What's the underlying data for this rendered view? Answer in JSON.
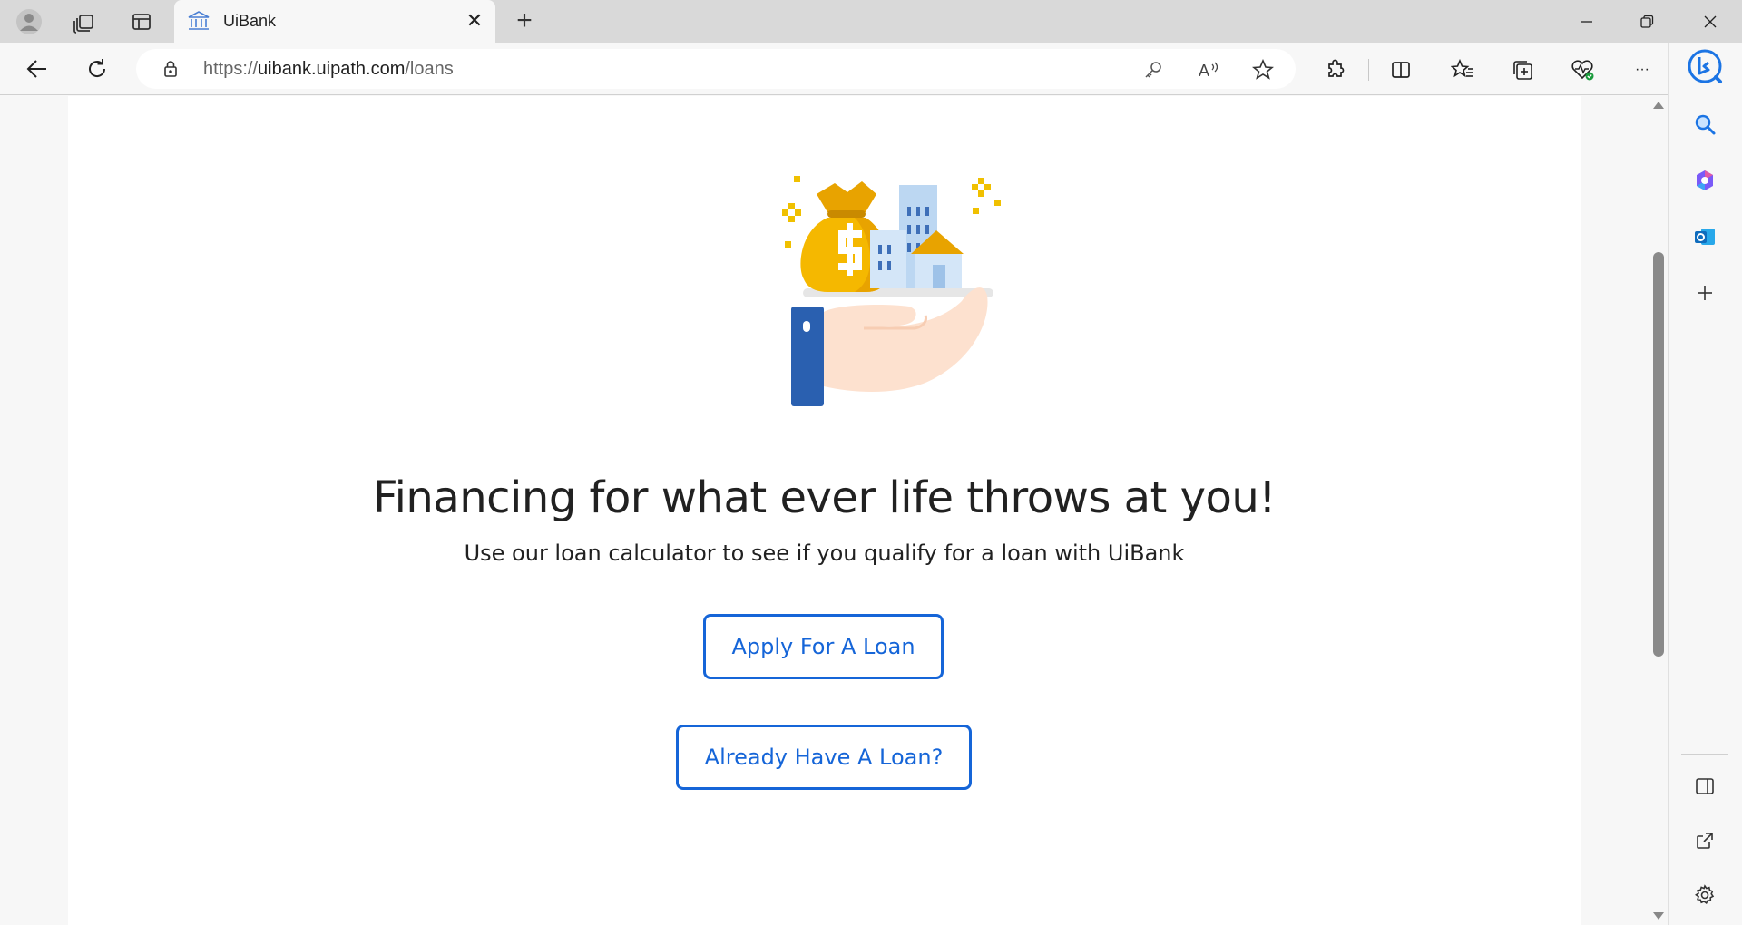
{
  "browser": {
    "tab": {
      "title": "UiBank",
      "close": "✕"
    },
    "new_tab": "+",
    "address": {
      "scheme": "https://",
      "host": "uibank.uipath.com",
      "path": "/loans"
    },
    "more": "···"
  },
  "page": {
    "headline": "Financing for what ever life throws at you!",
    "subline": "Use our loan calculator to see if you qualify for a loan with UiBank",
    "apply_button": "Apply For A Loan",
    "have_loan_button": "Already Have A Loan?"
  },
  "colors": {
    "accent": "#1565d8",
    "tab_bar": "#d9d9d9",
    "page_bg": "#ffffff"
  }
}
